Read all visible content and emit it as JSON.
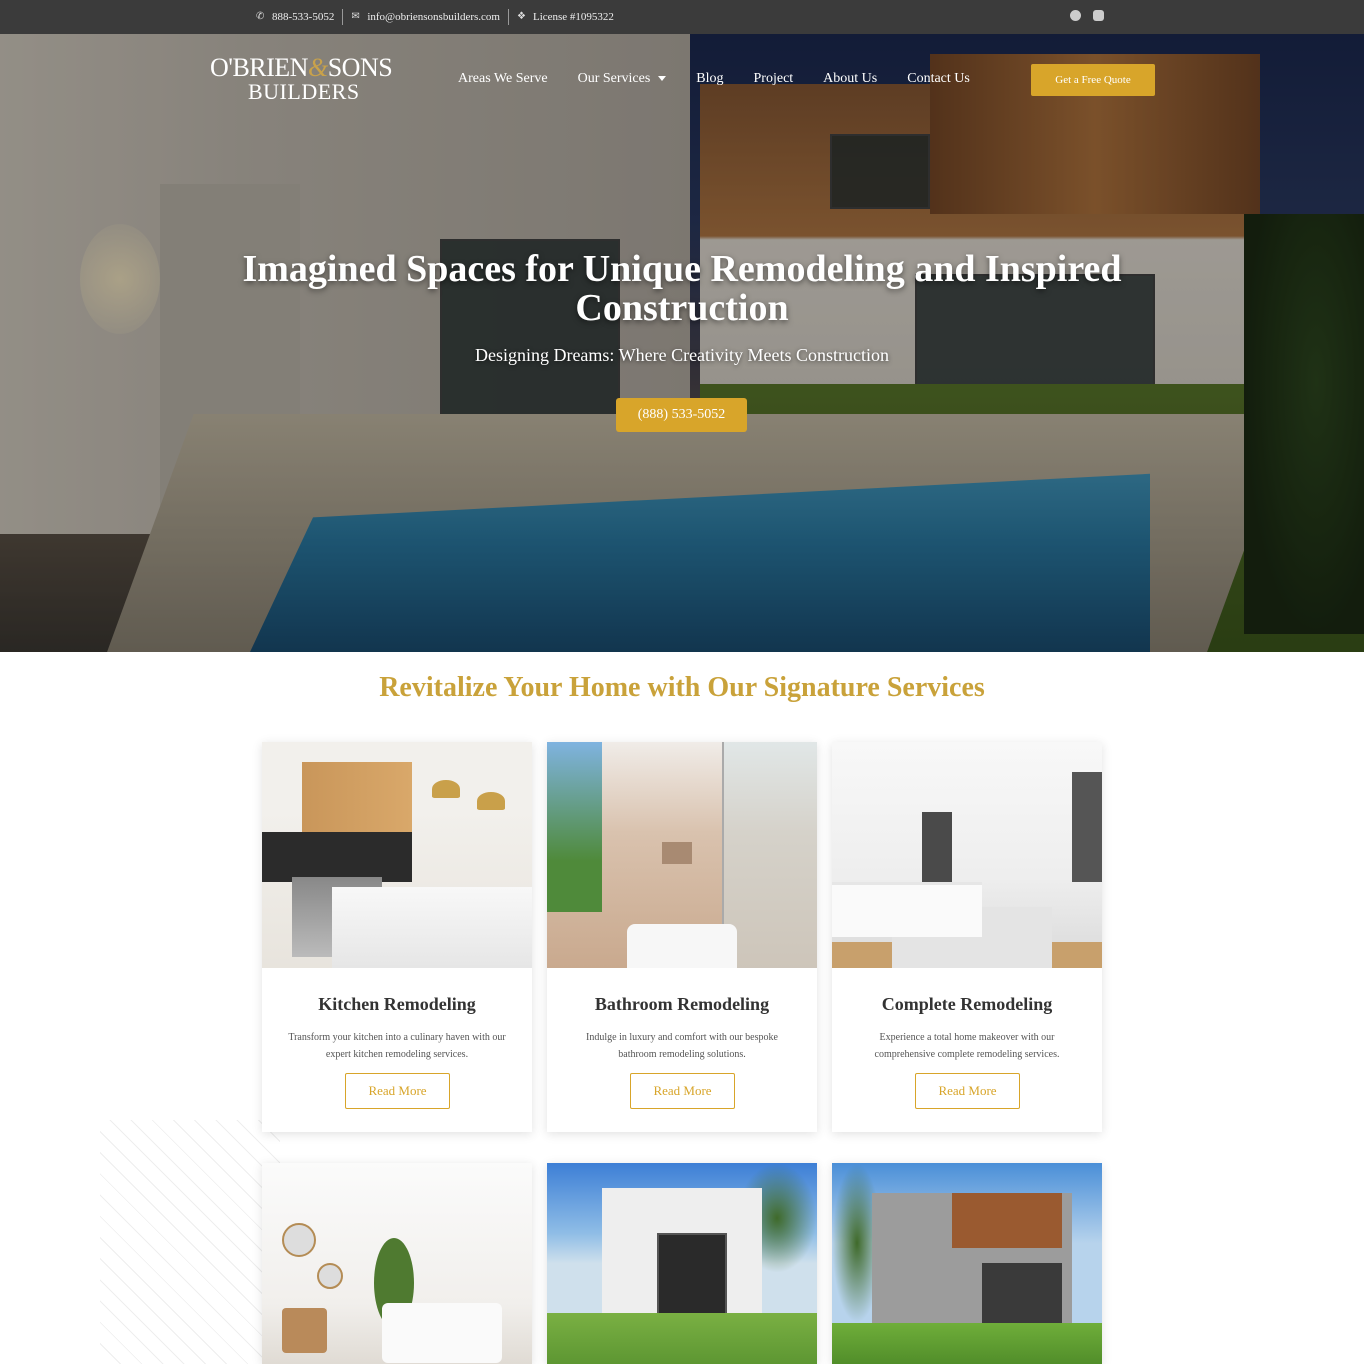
{
  "topbar": {
    "phone": "888-533-5052",
    "email": "info@obriensonsbuilders.com",
    "license": "License #1095322",
    "social": [
      "facebook-icon",
      "instagram-icon"
    ]
  },
  "header": {
    "logo": {
      "line1_a": "O'BRIEN",
      "amp": "&",
      "line1_b": "SONS",
      "line2": "BUILDERS"
    },
    "nav": [
      {
        "label": "Areas We Serve"
      },
      {
        "label": "Our Services"
      },
      {
        "label": "Blog"
      },
      {
        "label": "Project"
      },
      {
        "label": "About Us"
      },
      {
        "label": "Contact Us"
      }
    ],
    "cta_label": "Get a Free Quote"
  },
  "hero": {
    "title": "Imagined Spaces for Unique Remodeling and Inspired Construction",
    "subtitle": "Designing Dreams: Where Creativity Meets Construction",
    "phone_button": "(888) 533-5052"
  },
  "services": {
    "heading": "Revitalize Your Home with Our Signature Services",
    "cards": [
      {
        "title": "Kitchen Remodeling",
        "desc": "Transform your kitchen into a culinary haven with our expert kitchen remodeling services.",
        "button": "Read More"
      },
      {
        "title": "Bathroom Remodeling",
        "desc": "Indulge in luxury and comfort with our bespoke bathroom remodeling solutions.",
        "button": "Read More"
      },
      {
        "title": "Complete Remodeling",
        "desc": "Experience a total home makeover with our comprehensive complete remodeling services.",
        "button": "Read More"
      }
    ]
  },
  "colors": {
    "accent": "#d8a52a",
    "heading_gold": "#c9a23a",
    "topbar": "#3b3b3b"
  }
}
